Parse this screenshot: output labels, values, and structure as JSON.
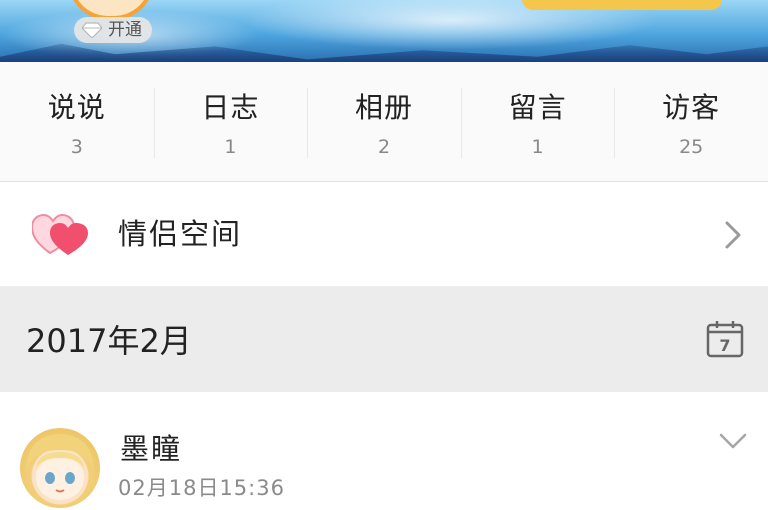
{
  "banner": {
    "open_badge_label": "开通"
  },
  "stats": [
    {
      "label": "说说",
      "count": "3"
    },
    {
      "label": "日志",
      "count": "1"
    },
    {
      "label": "相册",
      "count": "2"
    },
    {
      "label": "留言",
      "count": "1"
    },
    {
      "label": "访客",
      "count": "25"
    }
  ],
  "couple_space": {
    "label": "情侣空间",
    "icon": "double-heart-icon"
  },
  "month_header": {
    "label": "2017年2月",
    "calendar_icon_day": "7"
  },
  "post": {
    "author": "墨瞳",
    "timestamp": "02月18日15:36"
  },
  "colors": {
    "heart_pink": "#f0506e",
    "accent_orange": "#f7a233"
  }
}
